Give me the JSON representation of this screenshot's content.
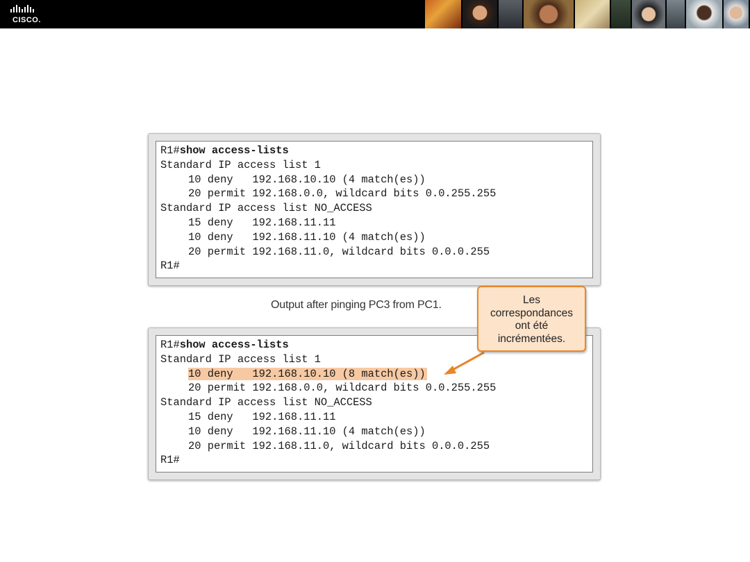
{
  "header": {
    "logo_text": "CISCO.",
    "photo_count": 10
  },
  "terminal_top": {
    "lines": [
      {
        "prompt": "R1#",
        "command": "show access-lists"
      },
      {
        "text": "Standard IP access list 1"
      },
      {
        "text": "10 deny   192.168.10.10 (4 match(es))"
      },
      {
        "text": "20 permit 192.168.0.0, wildcard bits 0.0.255.255"
      },
      {
        "text": "Standard IP access list NO_ACCESS"
      },
      {
        "text": "15 deny   192.168.11.11"
      },
      {
        "text": "10 deny   192.168.11.10 (4 match(es))"
      },
      {
        "text": "20 permit 192.168.11.0, wildcard bits 0.0.0.255"
      },
      {
        "text": "R1#"
      }
    ]
  },
  "caption": "Output after pinging PC3 from PC1.",
  "terminal_bottom": {
    "lines": [
      {
        "prompt": "R1#",
        "command": "show access-lists"
      },
      {
        "text": "Standard IP access list 1"
      },
      {
        "text": "10 deny   192.168.10.10 (8 match(es))"
      },
      {
        "text": "20 permit 192.168.0.0, wildcard bits 0.0.255.255"
      },
      {
        "text": "Standard IP access list NO_ACCESS"
      },
      {
        "text": "15 deny   192.168.11.11"
      },
      {
        "text": "10 deny   192.168.11.10 (4 match(es))"
      },
      {
        "text": "20 permit 192.168.11.0, wildcard bits 0.0.0.255"
      },
      {
        "text": "R1#"
      }
    ]
  },
  "callout": {
    "lines": [
      "Les",
      "correspondances",
      "ont été",
      "incrémentées."
    ]
  },
  "colors": {
    "header_bg": "#000000",
    "highlight": "#f7c9a3",
    "callout_bg": "#fde3ca",
    "callout_border": "#e8862a"
  }
}
